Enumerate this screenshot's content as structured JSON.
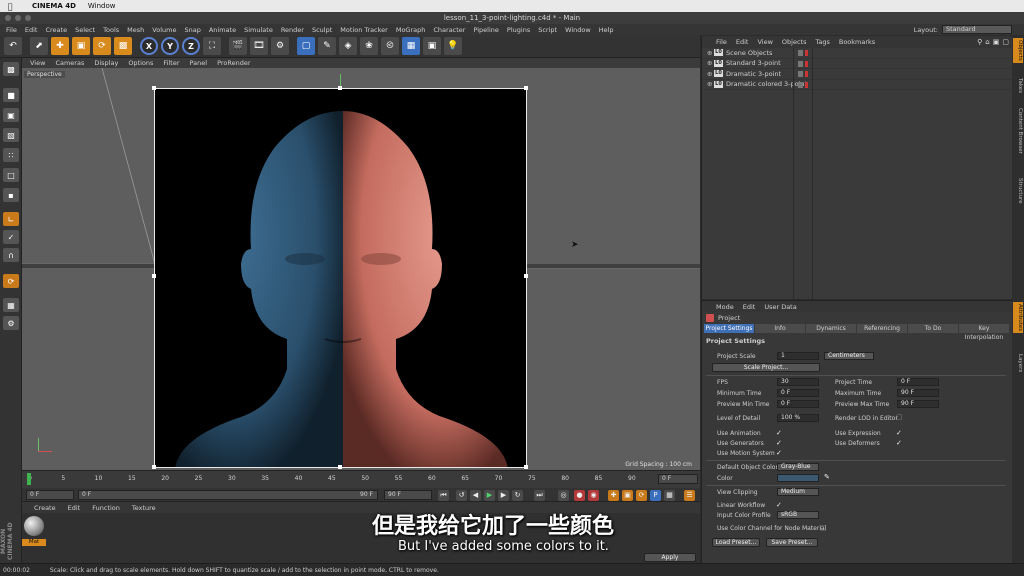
{
  "mac_menubar": {
    "app": "CINEMA 4D",
    "window": "Window"
  },
  "titlebar": {
    "title": "lesson_11_3-point-lighting.c4d * - Main"
  },
  "app_menu": [
    "File",
    "Edit",
    "Create",
    "Select",
    "Tools",
    "Mesh",
    "Volume",
    "Snap",
    "Animate",
    "Simulate",
    "Render",
    "Sculpt",
    "Motion Tracker",
    "MoGraph",
    "Character",
    "Pipeline",
    "Plugins",
    "Script",
    "Window",
    "Help"
  ],
  "layout": {
    "label": "Layout:",
    "value": "Standard"
  },
  "toolbar": {
    "x_label": "X",
    "y_label": "Y",
    "z_label": "Z"
  },
  "viewport": {
    "menu": [
      "View",
      "Cameras",
      "Display",
      "Options",
      "Filter",
      "Panel",
      "ProRender"
    ],
    "label": "Perspective",
    "grid_spacing": "Grid Spacing : 100 cm"
  },
  "timeline": {
    "ticks": [
      "0",
      "5",
      "10",
      "15",
      "20",
      "25",
      "30",
      "35",
      "40",
      "45",
      "50",
      "55",
      "60",
      "65",
      "70",
      "75",
      "80",
      "85",
      "90"
    ],
    "current_frame": "0 F"
  },
  "transport": {
    "start": "0 F",
    "preview_start": "0 F",
    "preview_end": "90 F",
    "end": "90 F"
  },
  "material_manager": {
    "menu": [
      "Create",
      "Edit",
      "Function",
      "Texture"
    ],
    "material_name": "Mat",
    "apply_label": "Apply",
    "brand": "MAXON CINEMA 4D"
  },
  "statusbar": {
    "time": "00:00:02",
    "message": "Scale: Click and drag to scale elements. Hold down SHIFT to quantize scale / add to the selection in point mode, CTRL to remove."
  },
  "subtitles": {
    "cn": "但是我给它加了一些颜色",
    "en": "But I've added some colors to it."
  },
  "object_manager": {
    "menu": [
      "File",
      "Edit",
      "View",
      "Objects",
      "Tags",
      "Bookmarks"
    ],
    "items": [
      {
        "label": "Scene Objects"
      },
      {
        "label": "Standard 3-point"
      },
      {
        "label": "Dramatic 3-point"
      },
      {
        "label": "Dramatic colored 3-point"
      }
    ]
  },
  "right_tabs": {
    "top": [
      "Objects",
      "Takes",
      "Content Browser",
      "Structure"
    ],
    "bottom": [
      "Attributes",
      "Layers"
    ]
  },
  "attributes": {
    "menu": [
      "Mode",
      "Edit",
      "User Data"
    ],
    "title": "Project",
    "tabs": [
      "Project Settings",
      "Info",
      "Dynamics",
      "Referencing",
      "To Do",
      "Key Interpolation"
    ],
    "section": "Project Settings",
    "project_scale": {
      "label": "Project Scale",
      "value": "1",
      "unit": "Centimeters"
    },
    "scale_project_button": "Scale Project...",
    "fps": {
      "label": "FPS",
      "value": "30"
    },
    "project_time": {
      "label": "Project Time",
      "value": "0 F"
    },
    "minimum_time": {
      "label": "Minimum Time",
      "value": "0 F"
    },
    "maximum_time": {
      "label": "Maximum Time",
      "value": "90 F"
    },
    "preview_min_time": {
      "label": "Preview Min Time",
      "value": "0 F"
    },
    "preview_max_time": {
      "label": "Preview Max Time",
      "value": "90 F"
    },
    "level_of_detail": {
      "label": "Level of Detail",
      "value": "100 %"
    },
    "render_lod": {
      "label": "Render LOD in Editor"
    },
    "use_animation": {
      "label": "Use Animation",
      "checked": true
    },
    "use_expression": {
      "label": "Use Expression",
      "checked": true
    },
    "use_generators": {
      "label": "Use Generators",
      "checked": true
    },
    "use_deformers": {
      "label": "Use Deformers",
      "checked": true
    },
    "use_motion_system": {
      "label": "Use Motion System",
      "checked": true
    },
    "default_object_color": {
      "label": "Default Object Color",
      "value": "Gray-Blue"
    },
    "color": {
      "label": "Color"
    },
    "view_clipping": {
      "label": "View Clipping",
      "value": "Medium"
    },
    "linear_workflow": {
      "label": "Linear Workflow",
      "checked": true
    },
    "input_color_profile": {
      "label": "Input Color Profile",
      "value": "sRGB"
    },
    "node_material": {
      "label": "Use Color Channel for Node Material"
    },
    "load_preset_button": "Load Preset...",
    "save_preset_button": "Save Preset..."
  },
  "colors": {
    "accent": "#d98a1c",
    "active_tab": "#3f6fb5"
  }
}
